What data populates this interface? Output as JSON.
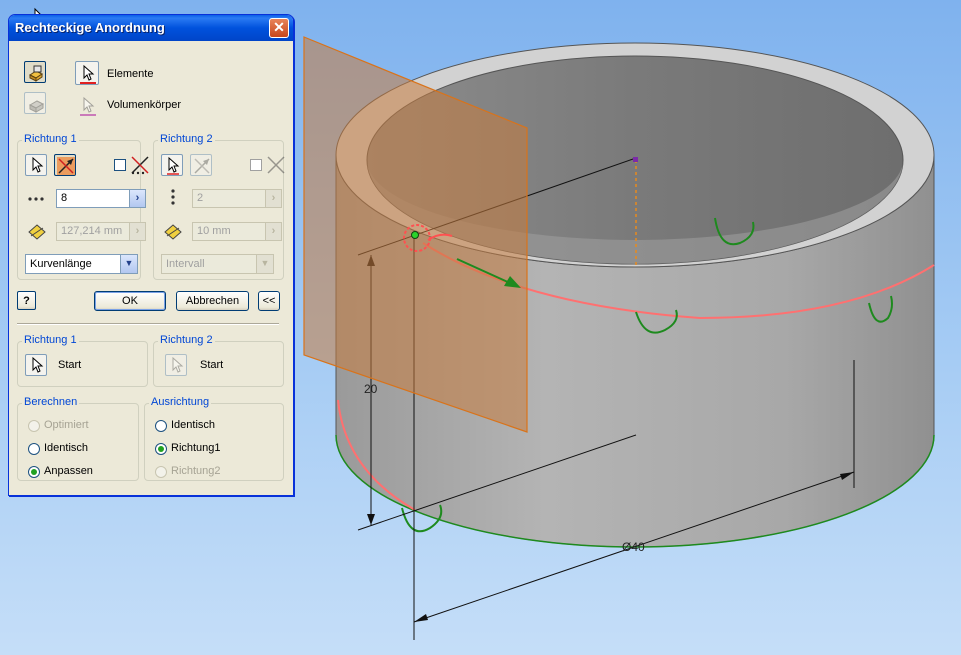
{
  "dialog": {
    "title": "Rechteckige Anordnung",
    "close_label": "✕",
    "selection": {
      "elements_label": "Elemente",
      "solids_label": "Volumenkörper"
    },
    "direction1": {
      "legend": "Richtung 1",
      "count": "8",
      "distance": "127,214 mm",
      "spacing_mode": "Kurvenlänge"
    },
    "direction2": {
      "legend": "Richtung 2",
      "count": "2",
      "distance": "10 mm",
      "spacing_mode": "Intervall"
    },
    "buttons": {
      "help": "?",
      "ok": "OK",
      "cancel": "Abbrechen",
      "collapse": "<<"
    },
    "start": {
      "direction1_legend": "Richtung 1",
      "direction1_label": "Start",
      "direction2_legend": "Richtung 2",
      "direction2_label": "Start"
    },
    "compute": {
      "legend": "Berechnen",
      "options": [
        "Optimiert",
        "Identisch",
        "Anpassen"
      ],
      "selected": "Anpassen"
    },
    "orientation": {
      "legend": "Ausrichtung",
      "options": [
        "Identisch",
        "Richtung1",
        "Richtung2"
      ],
      "selected": "Richtung1"
    }
  },
  "model": {
    "height_dimension": "20",
    "diameter_dimension": "Ø40",
    "colors": {
      "solid": "#a9a9a9",
      "work_plane": "#c77b3e",
      "path_curve": "#ff7070",
      "features": "#1e8a1e"
    }
  }
}
